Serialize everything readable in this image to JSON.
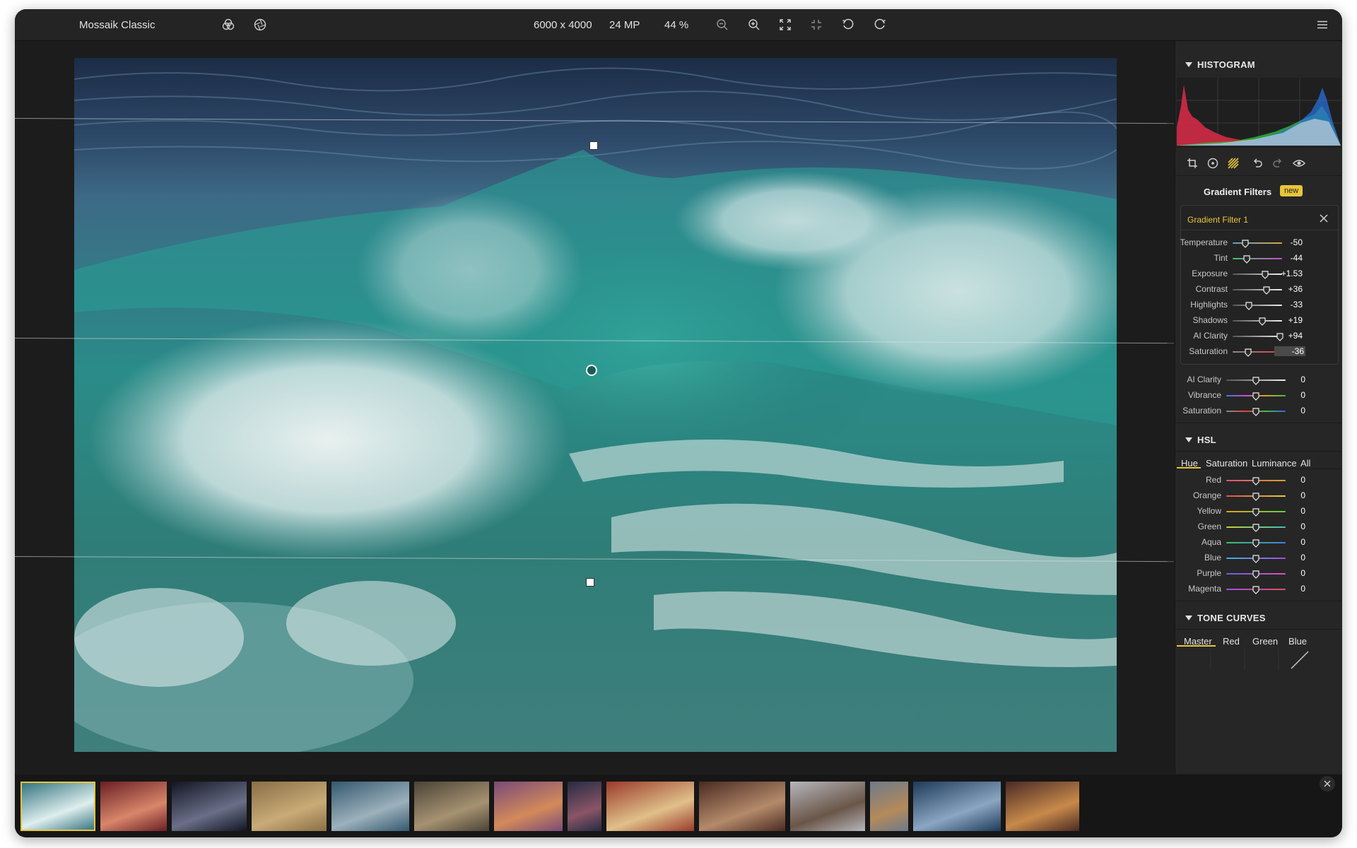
{
  "toolbar": {
    "preset_name": "Mossaik Classic",
    "dimensions": "6000 x 4000",
    "megapixels": "24 MP",
    "zoom": "44 %"
  },
  "histogram": {
    "title": "HISTOGRAM"
  },
  "gradient_filters": {
    "title": "Gradient Filters",
    "badge": "new",
    "filter_name": "Gradient Filter 1",
    "sliders": [
      {
        "label": "Temperature",
        "value": "-50",
        "level": 0.25,
        "track": "#5a9fd0 #d8a83a"
      },
      {
        "label": "Tint",
        "value": "-44",
        "level": 0.28,
        "track": "#3fc36a #c84fd6"
      },
      {
        "label": "Exposure",
        "value": "+1.53",
        "level": 0.65,
        "track": "#555555 #eeeeee"
      },
      {
        "label": "Contrast",
        "value": "+36",
        "level": 0.68,
        "track": "#555555 #eeeeee"
      },
      {
        "label": "Highlights",
        "value": "-33",
        "level": 0.33,
        "track": "#555555 #eeeeee"
      },
      {
        "label": "Shadows",
        "value": "+19",
        "level": 0.6,
        "track": "#555555 #eeeeee"
      },
      {
        "label": "AI Clarity",
        "value": "+94",
        "level": 0.95,
        "track": "#555555 #eeeeee"
      },
      {
        "label": "Saturation",
        "value": "-36",
        "level": 0.32,
        "track": "#888888 #e04040"
      }
    ]
  },
  "global_sliders": [
    {
      "label": "AI Clarity",
      "value": "0",
      "level": 0.5
    },
    {
      "label": "Vibrance",
      "value": "0",
      "level": 0.5
    },
    {
      "label": "Saturation",
      "value": "0",
      "level": 0.5
    }
  ],
  "hsl": {
    "title": "HSL",
    "tabs": [
      "Hue",
      "Saturation",
      "Luminance",
      "All"
    ],
    "active_tab": "Hue",
    "sliders": [
      {
        "label": "Red",
        "value": "0",
        "level": 0.5
      },
      {
        "label": "Orange",
        "value": "0",
        "level": 0.5
      },
      {
        "label": "Yellow",
        "value": "0",
        "level": 0.5
      },
      {
        "label": "Green",
        "value": "0",
        "level": 0.5
      },
      {
        "label": "Aqua",
        "value": "0",
        "level": 0.5
      },
      {
        "label": "Blue",
        "value": "0",
        "level": 0.5
      },
      {
        "label": "Purple",
        "value": "0",
        "level": 0.5
      },
      {
        "label": "Magenta",
        "value": "0",
        "level": 0.5
      }
    ]
  },
  "tone_curves": {
    "title": "TONE CURVES",
    "tabs": [
      "Master",
      "Red",
      "Green",
      "Blue"
    ],
    "active_tab": "Master"
  },
  "filmstrip": {
    "thumbnails": [
      "wave",
      "nixie-tubes",
      "mountains-night",
      "hay-stacks",
      "wooden-house",
      "empty-room",
      "street-art",
      "neon-street",
      "nesting-dolls",
      "market-stall",
      "bare-tree",
      "camel",
      "lake-balloon",
      "cathedral"
    ],
    "selected_index": 0
  },
  "colors": {
    "accent": "#e8c53a",
    "panel": "#262626",
    "canvas": "#1c1c1c"
  }
}
